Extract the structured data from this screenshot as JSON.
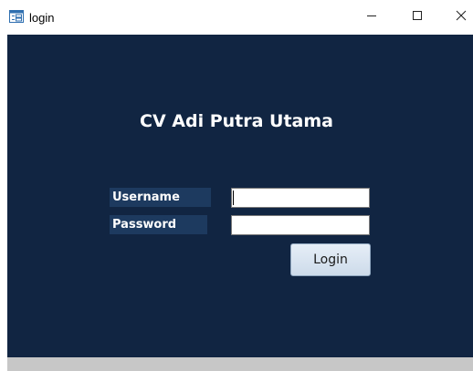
{
  "window": {
    "title": "login",
    "icons": {
      "app": "form-icon",
      "minimize": "minimize-icon",
      "maximize": "maximize-icon",
      "close": "close-icon"
    }
  },
  "form": {
    "company_title": "CV Adi Putra Utama",
    "username_label": "Username",
    "password_label": "Password",
    "username_value": "",
    "password_value": "",
    "login_label": "Login"
  },
  "colors": {
    "background": "#112542",
    "label_background": "#1d3a5f",
    "title_text": "#ffffff",
    "button_background": "#dbe6f2"
  }
}
